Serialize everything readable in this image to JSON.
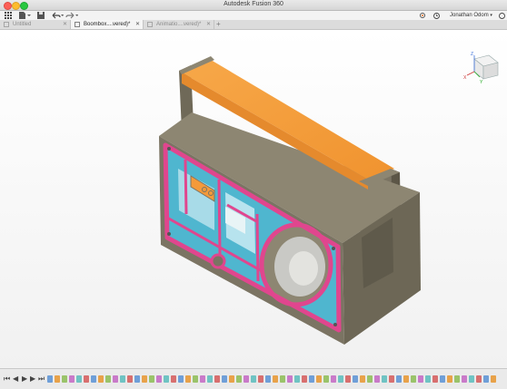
{
  "window": {
    "title": "Autodesk Fusion 360"
  },
  "toolbar": {
    "user_name": "Jonathan Odom"
  },
  "tabs": [
    {
      "label": "Untitled",
      "active": false
    },
    {
      "label": "Boombox....vered)*",
      "active": true
    },
    {
      "label": "Animatio....vered)*",
      "active": false
    }
  ],
  "viewcube": {
    "axis_x": "X",
    "axis_y": "Y",
    "axis_z": "Z"
  },
  "colors": {
    "body": "#7b7463",
    "body_light": "#948c78",
    "handle": "#f49a3a",
    "frame": "#e0468e",
    "panel": "#4fb6cf",
    "speaker": "#c9c9c5",
    "accent": "#e8742a"
  },
  "icons": {
    "apps": "grid-icon",
    "file": "file-icon",
    "save": "save-icon",
    "undo": "undo-icon",
    "redo": "redo-icon",
    "record": "record-icon",
    "clock": "clock-icon"
  }
}
